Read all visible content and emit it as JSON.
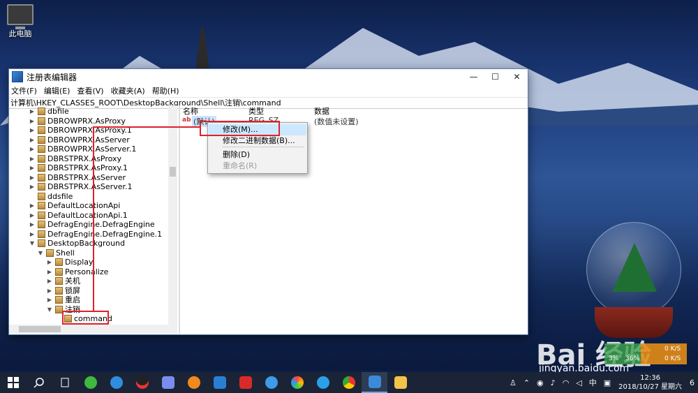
{
  "desktop": {
    "this_pc_label": "此电脑"
  },
  "window": {
    "title": "注册表编辑器",
    "controls": {
      "minimize": "—",
      "maximize": "☐",
      "close": "✕"
    },
    "menu": [
      "文件(F)",
      "编辑(E)",
      "查看(V)",
      "收藏夹(A)",
      "帮助(H)"
    ],
    "address": "计算机\\HKEY_CLASSES_ROOT\\DesktopBackground\\Shell\\注销\\command"
  },
  "tree": [
    {
      "label": "dbfile",
      "expanded": false
    },
    {
      "label": "DBROWPRX.AsProxy",
      "expanded": false
    },
    {
      "label": "DBROWPRX.AsProxy.1",
      "expanded": false
    },
    {
      "label": "DBROWPRX.AsServer",
      "expanded": false
    },
    {
      "label": "DBROWPRX.AsServer.1",
      "expanded": false
    },
    {
      "label": "DBRSTPRX.AsProxy",
      "expanded": false
    },
    {
      "label": "DBRSTPRX.AsProxy.1",
      "expanded": false
    },
    {
      "label": "DBRSTPRX.AsServer",
      "expanded": false
    },
    {
      "label": "DBRSTPRX.AsServer.1",
      "expanded": false
    },
    {
      "label": "ddsfile",
      "expanded": false
    },
    {
      "label": "DefaultLocationApi",
      "expanded": false
    },
    {
      "label": "DefaultLocationApi.1",
      "expanded": false
    },
    {
      "label": "DefragEngine.DefragEngine",
      "expanded": false
    },
    {
      "label": "DefragEngine.DefragEngine.1",
      "expanded": false
    },
    {
      "label": "DesktopBackground",
      "expanded": true
    },
    {
      "label": "Shell",
      "expanded": true
    },
    {
      "label": "Display",
      "expanded": false
    },
    {
      "label": "Personalize",
      "expanded": false
    },
    {
      "label": "关机",
      "expanded": false
    },
    {
      "label": "锁屏",
      "expanded": false
    },
    {
      "label": "重启",
      "expanded": false
    },
    {
      "label": "注销",
      "expanded": true
    },
    {
      "label": "command",
      "expanded": false
    }
  ],
  "list": {
    "headers": [
      "名称",
      "类型",
      "数据"
    ],
    "rows": [
      {
        "name": "(默认)",
        "type": "REG_SZ",
        "data": "(数值未设置)"
      }
    ]
  },
  "context_menu": [
    {
      "label": "修改(M)...",
      "highlighted": true,
      "disabled": false
    },
    {
      "label": "修改二进制数据(B)...",
      "highlighted": false,
      "disabled": false
    },
    {
      "label": "删除(D)",
      "highlighted": false,
      "disabled": false
    },
    {
      "label": "重命名(R)",
      "highlighted": false,
      "disabled": true
    }
  ],
  "watermark": {
    "brand": "Bai 经验",
    "url": "jingyan.baidu.com"
  },
  "net_meter": {
    "up_percent": "3%",
    "cpu_percent": "36%",
    "up": "0 K/S",
    "down": "0 K/S"
  },
  "taskbar": {
    "apps": [
      "start-icon",
      "search-icon",
      "task-view-icon",
      "wechat-icon",
      "k-app-icon",
      "qq-icon",
      "feishu-icon",
      "browser-orange-icon",
      "app-blue-icon",
      "it-icon",
      "edge-icon",
      "photos-icon",
      "qq-lite-icon",
      "chrome-icon",
      "regedit-icon",
      "explorer-icon"
    ],
    "tray": {
      "ime": "中",
      "time": "12:36",
      "date": "2018/10/27 星期六",
      "notifications": "6"
    }
  },
  "colors": {
    "annotation_red": "#e0202a",
    "highlight": "#cce8ff",
    "taskbar": "#1b2436"
  }
}
